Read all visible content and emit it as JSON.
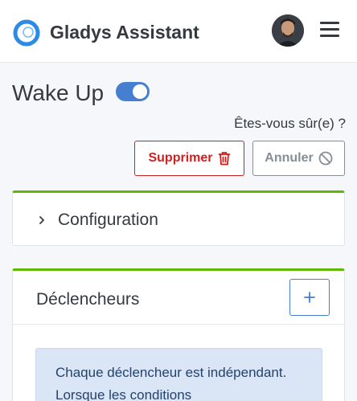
{
  "header": {
    "app_title": "Gladys Assistant",
    "logo_icon": "gladys-logo-icon",
    "avatar_icon": "user-avatar",
    "menu_icon": "hamburger-menu-icon"
  },
  "scene": {
    "title": "Wake Up",
    "active": true,
    "confirm_text": "Êtes-vous sûr(e) ?",
    "delete_label": "Supprimer",
    "delete_icon": "trash-icon",
    "cancel_label": "Annuler",
    "cancel_icon": "ban-icon"
  },
  "configuration": {
    "label": "Configuration",
    "expanded": false
  },
  "triggers": {
    "title": "Déclencheurs",
    "add_icon": "plus-icon",
    "info_text": "Chaque déclencheur est indépendant. Lorsque les conditions"
  },
  "colors": {
    "accent": "#467fcf",
    "danger": "#cd201f",
    "card_top_border": "#5eba00",
    "info_bg": "#dae5f5"
  }
}
